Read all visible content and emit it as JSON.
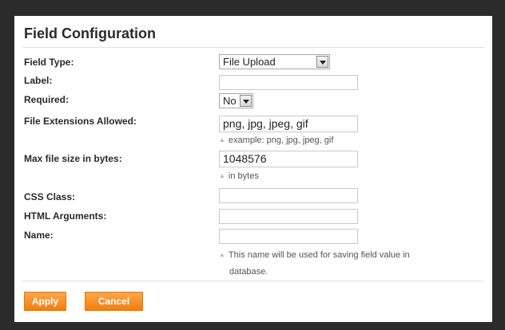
{
  "dialog": {
    "title": "Field Configuration"
  },
  "fields": {
    "field_type": {
      "label": "Field Type:",
      "value": "File Upload"
    },
    "label": {
      "label": "Label:",
      "value": ""
    },
    "required": {
      "label": "Required:",
      "value": "No"
    },
    "file_extensions": {
      "label": "File Extensions Allowed:",
      "value": "png, jpg, jpeg, gif",
      "hint": "example: png, jpg, jpeg, gif"
    },
    "max_file_size": {
      "label": "Max file size in bytes:",
      "value": "1048576",
      "hint": "in bytes"
    },
    "css_class": {
      "label": "CSS Class:",
      "value": ""
    },
    "html_arguments": {
      "label": "HTML Arguments:",
      "value": ""
    },
    "name": {
      "label": "Name:",
      "value": "",
      "hint_line1": "This name will be used for saving field value in",
      "hint_line2": "database."
    }
  },
  "buttons": {
    "apply": "Apply",
    "cancel": "Cancel"
  },
  "colors": {
    "accent": "#f28a1c",
    "frame": "#2b2b2b"
  },
  "icons": {
    "hint": "triangle-up-icon",
    "dropdown": "chevron-down-icon"
  }
}
